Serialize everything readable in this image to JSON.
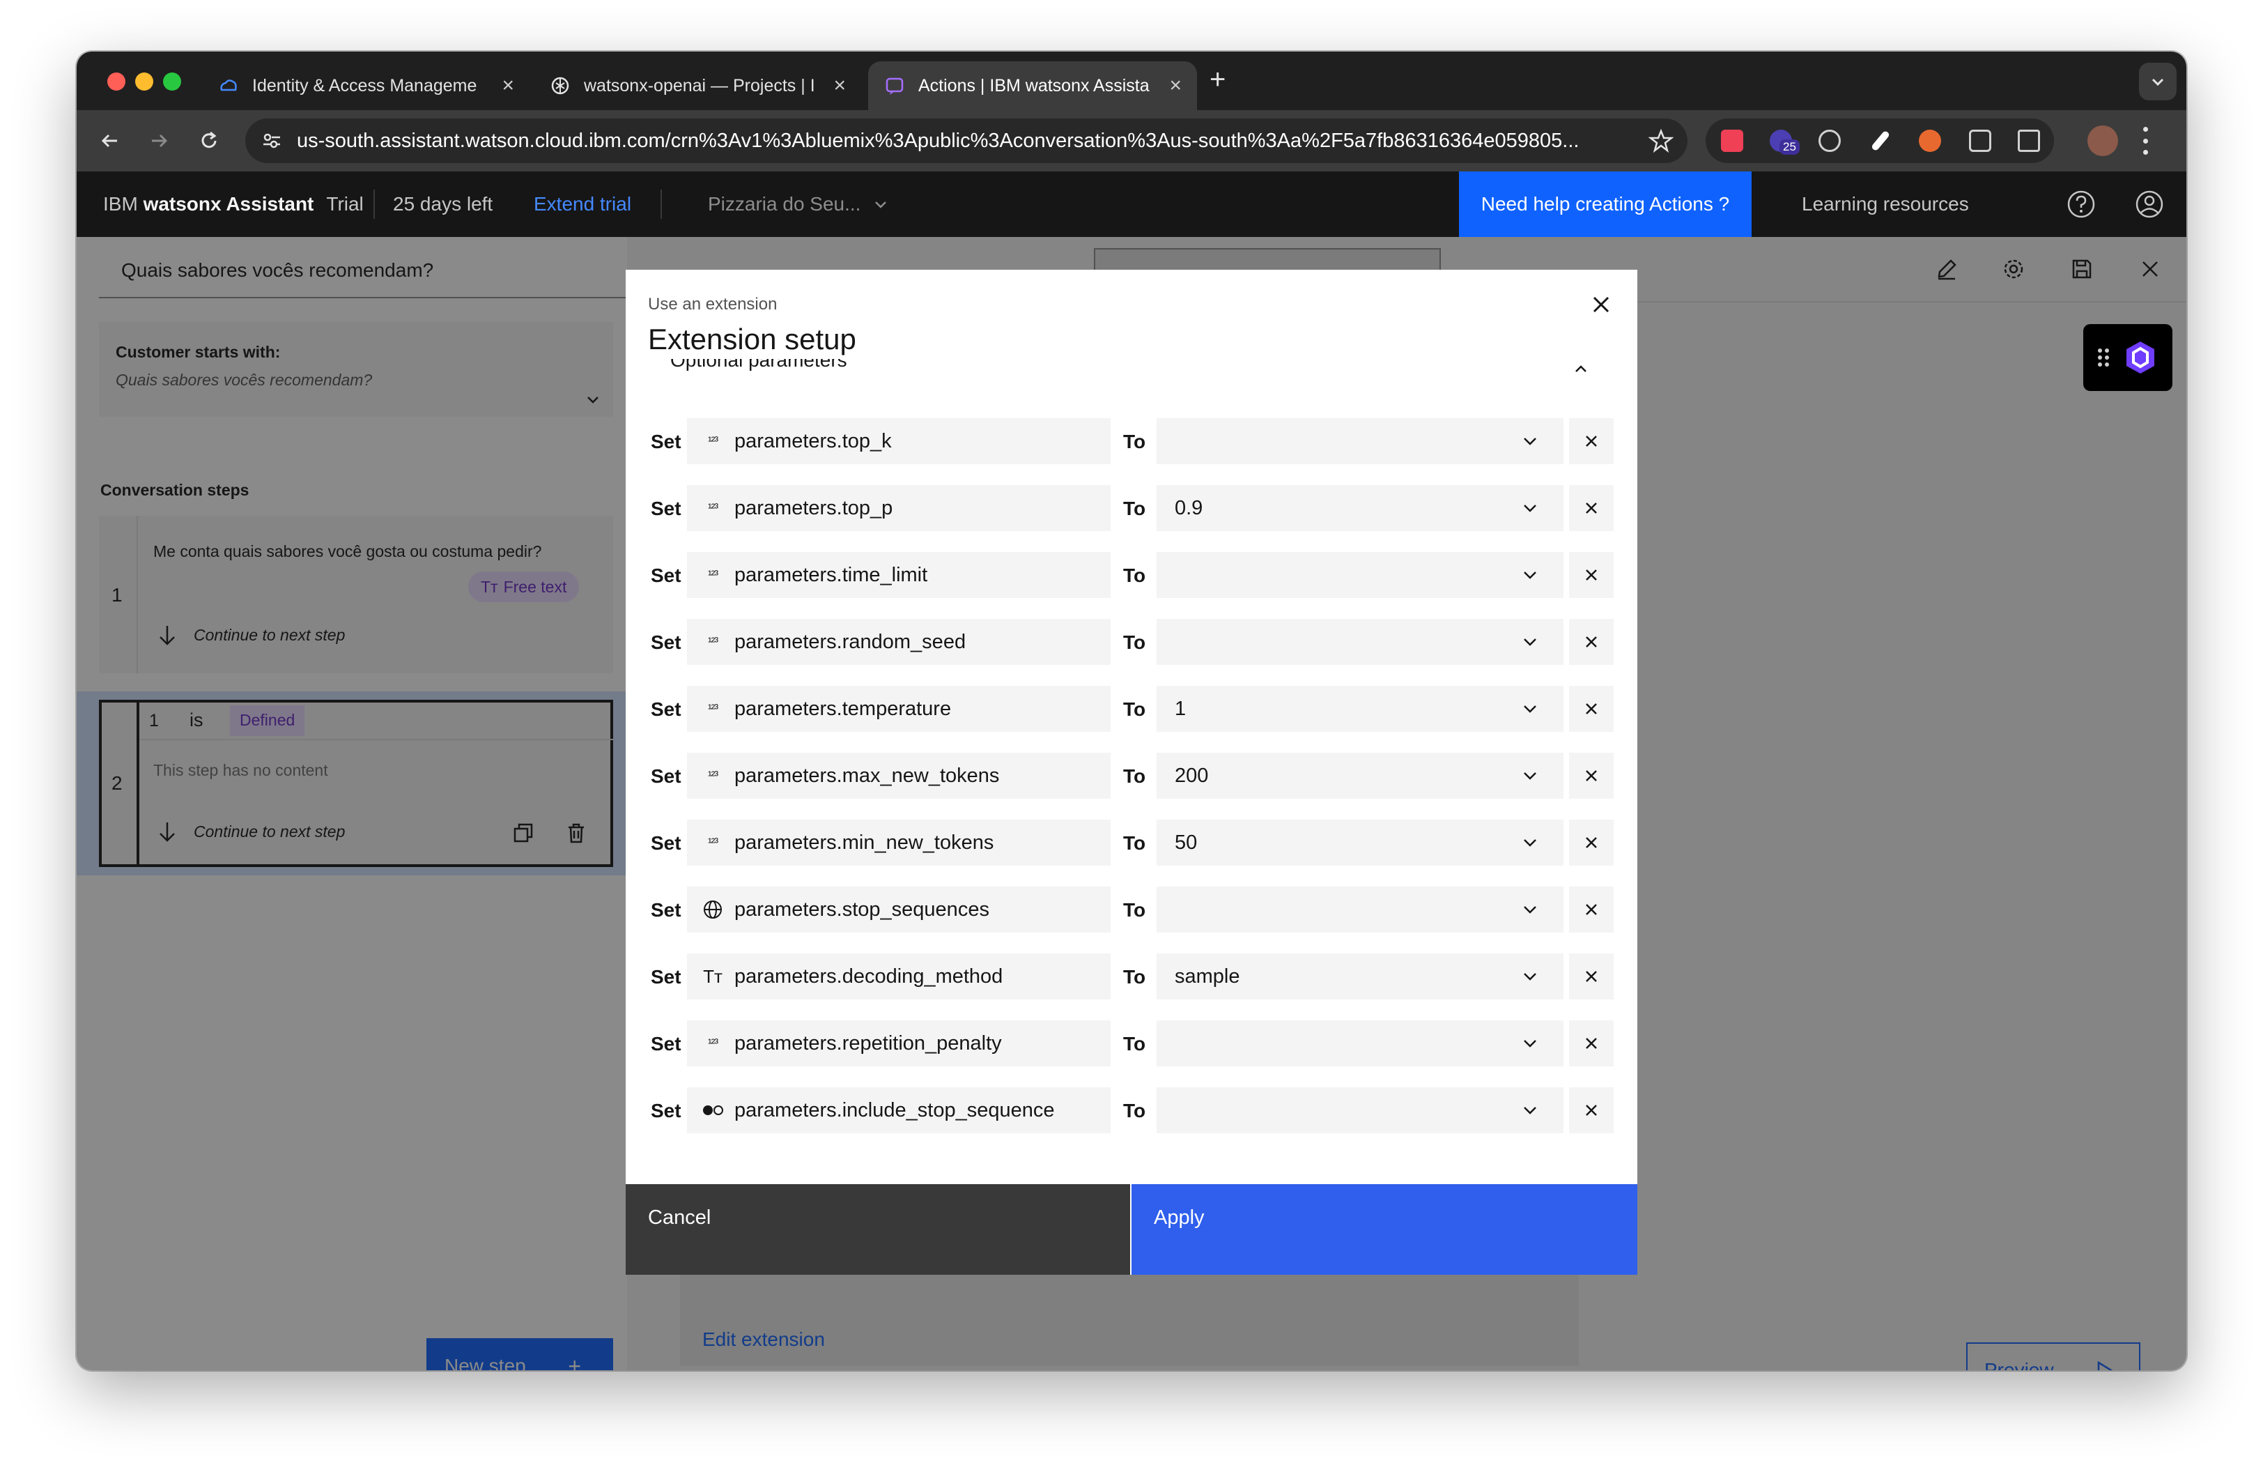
{
  "browser": {
    "tabs": [
      {
        "title": "Identity & Access Manageme",
        "active": false
      },
      {
        "title": "watsonx-openai — Projects | I",
        "active": false
      },
      {
        "title": "Actions | IBM watsonx Assista",
        "active": true
      }
    ],
    "new_tab_glyph": "+",
    "url": "us-south.assistant.watson.cloud.ibm.com/crn%3Av1%3Abluemix%3Apublic%3Aconversation%3Aus-south%3Aa%2F5a7fb86316364e059805...",
    "extension_badge": "25"
  },
  "app_header": {
    "brand_prefix": "IBM ",
    "brand_product": "watsonx Assistant",
    "plan": "Trial",
    "days_left": "25 days left",
    "extend_trial": "Extend trial",
    "assistant_name": "Pizzaria do Seu...",
    "help_button": "Need help creating Actions ?",
    "learning_resources": "Learning resources"
  },
  "action_editor": {
    "action_title": "Quais sabores vocês recomendam?",
    "customer_starts_label": "Customer starts with:",
    "customer_starts_value": "Quais sabores vocês recomendam?",
    "conversation_steps_label": "Conversation steps",
    "steps": [
      {
        "number": "1",
        "text": "Me conta quais sabores você gosta ou costuma pedir?",
        "tag": "Free text",
        "next": "Continue to next step"
      },
      {
        "number": "2",
        "condition_number": "1",
        "condition_op": "is",
        "condition_value": "Defined",
        "text": "This step has no content",
        "next": "Continue to next step"
      }
    ],
    "new_step_label": "New step",
    "edit_extension_link": "Edit extension",
    "preview_label": "Preview"
  },
  "modal": {
    "label": "Use an extension",
    "title": "Extension setup",
    "set_word": "Set",
    "to_word": "To",
    "section_label": "Optional parameters",
    "rows": [
      {
        "variable": "parameters.top_k",
        "type_icon": "number-icon",
        "value": ""
      },
      {
        "variable": "parameters.top_p",
        "type_icon": "number-icon",
        "value": "0.9"
      },
      {
        "variable": "parameters.time_limit",
        "type_icon": "number-icon",
        "value": ""
      },
      {
        "variable": "parameters.random_seed",
        "type_icon": "number-icon",
        "value": ""
      },
      {
        "variable": "parameters.temperature",
        "type_icon": "number-icon",
        "value": "1"
      },
      {
        "variable": "parameters.max_new_tokens",
        "type_icon": "number-icon",
        "value": "200"
      },
      {
        "variable": "parameters.min_new_tokens",
        "type_icon": "number-icon",
        "value": "50"
      },
      {
        "variable": "parameters.stop_sequences",
        "type_icon": "globe-icon",
        "value": ""
      },
      {
        "variable": "parameters.decoding_method",
        "type_icon": "text-type-icon",
        "value": "sample"
      },
      {
        "variable": "parameters.repetition_penalty",
        "type_icon": "number-icon",
        "value": ""
      },
      {
        "variable": "parameters.include_stop_sequence",
        "type_icon": "boolean-icon",
        "value": ""
      }
    ],
    "cancel_label": "Cancel",
    "apply_label": "Apply"
  },
  "colors": {
    "primary_blue": "#0f62fe",
    "apply_blue": "#2f5fec",
    "header_dark": "#161616",
    "tag_purple": "#e8daff"
  }
}
